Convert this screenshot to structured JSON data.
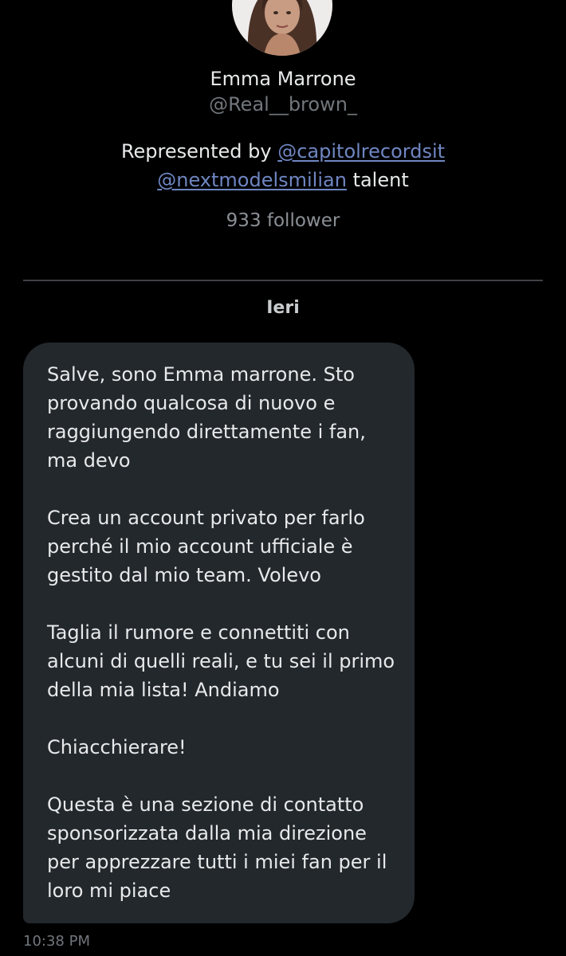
{
  "profile": {
    "name": "Emma Marrone",
    "handle": "@Real__brown_",
    "bio_prefix": "Represented by ",
    "bio_link1": "@capitolrecordsit",
    "bio_link2": "@nextmodelsmilian",
    "bio_suffix": " talent",
    "followers": "933 follower"
  },
  "conversation": {
    "day_label": "Ieri",
    "message": {
      "paragraphs": [
        "Salve, sono Emma marrone. Sto\nprovando qualcosa di nuovo e\nraggiungendo direttamente i fan,\nma devo",
        "Crea un account privato per farlo\nperché il mio account ufficiale è\ngestito dal mio team. Volevo",
        "Taglia il rumore e connettiti con\nalcuni di quelli reali, e tu sei il primo\ndella mia lista! Andiamo",
        "Chiacchierare!",
        "Questa è una sezione di contatto\nsponsorizzata dalla mia direzione\nper apprezzare tutti i miei fan per il\nloro mi piace"
      ],
      "timestamp": "10:38 PM"
    }
  },
  "colors": {
    "background": "#000000",
    "bubble": "#23282d",
    "link": "#6f86c2",
    "secondary_text": "#71767b"
  }
}
